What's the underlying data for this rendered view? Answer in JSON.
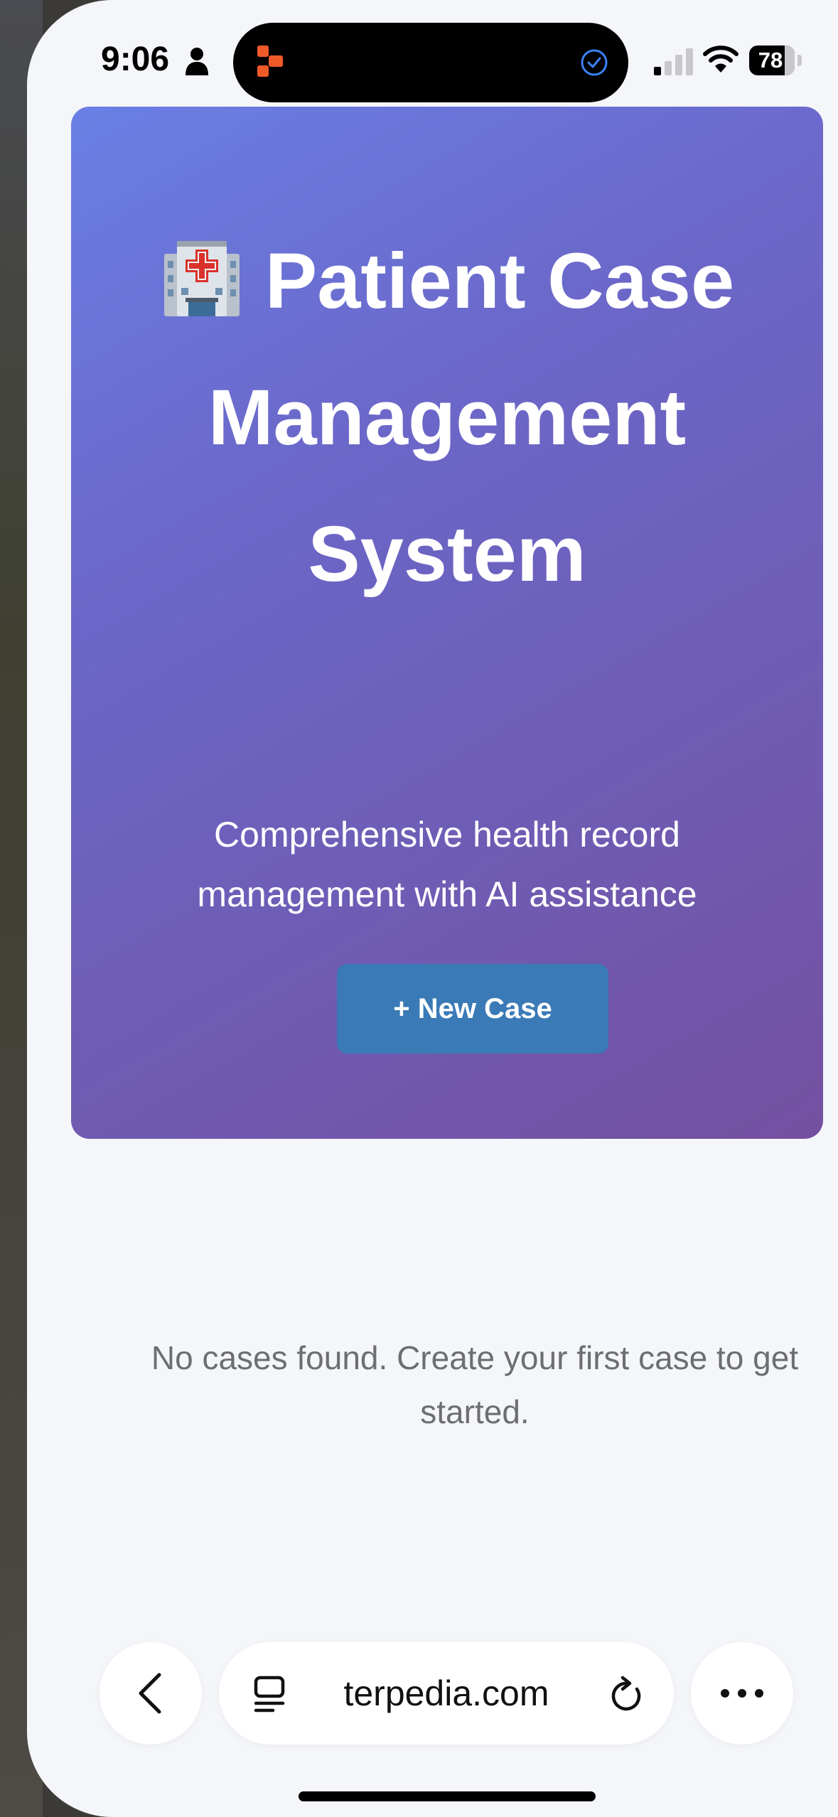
{
  "status_bar": {
    "time": "9:06",
    "battery_percent": "78",
    "battery_level": 0.78,
    "icons": [
      "person-icon",
      "app-icon",
      "check-circle-icon",
      "cellular-signal-icon",
      "wifi-icon",
      "battery-icon"
    ]
  },
  "hero": {
    "icon": "hospital-icon",
    "title": "Patient Case Management System",
    "subtitle": "Comprehensive health record management with AI assistance",
    "new_case_button": "+ New Case",
    "gradient_colors": [
      "#6a7fe4",
      "#7450a0"
    ],
    "button_color": "#3a7ab6"
  },
  "main": {
    "empty_message": "No cases found. Create your first case to get started."
  },
  "browser": {
    "url": "terpedia.com",
    "icons": [
      "chevron-left-icon",
      "tabs-icon",
      "reload-icon",
      "more-icon"
    ]
  }
}
